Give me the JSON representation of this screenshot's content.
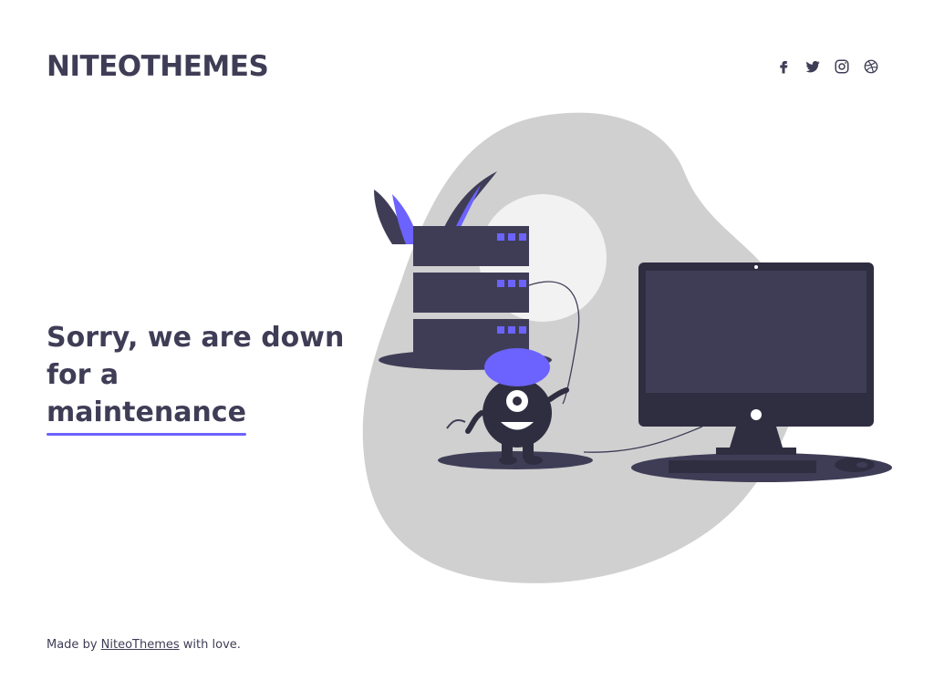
{
  "header": {
    "brand": "NITEOTHEMES",
    "social": [
      {
        "name": "facebook-icon"
      },
      {
        "name": "twitter-icon"
      },
      {
        "name": "instagram-icon"
      },
      {
        "name": "dribbble-icon"
      }
    ]
  },
  "main": {
    "headline_line1": "Sorry, we are down for a",
    "headline_highlight": "maintenance"
  },
  "footer": {
    "prefix": "Made by",
    "link": "NiteoThemes",
    "suffix": "with love."
  },
  "colors": {
    "accent": "#6c63ff",
    "dark": "#3f3d56",
    "blob": "#d0d0d0",
    "moon": "#f2f2f2"
  }
}
